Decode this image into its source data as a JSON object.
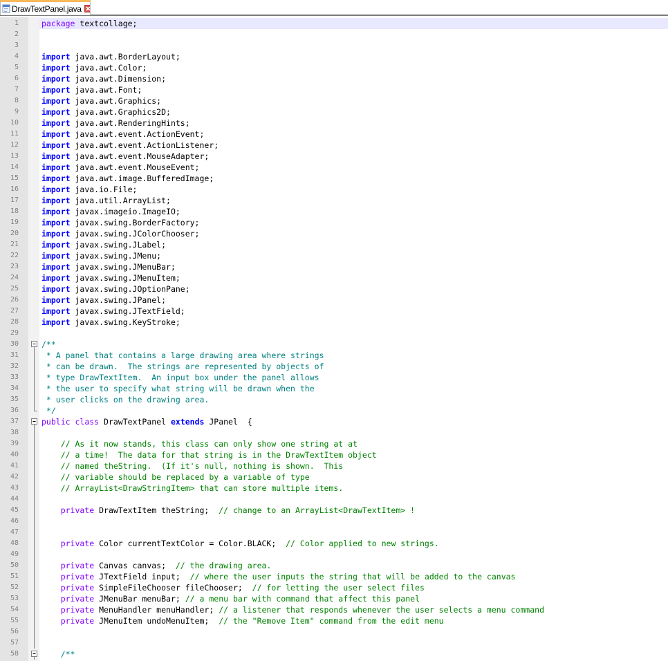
{
  "tab": {
    "filename": "DrawTextPanel.java",
    "icon": "java-file-icon",
    "close_icon": "close-icon"
  },
  "colors": {
    "keyword": "#0000ff",
    "type_keyword": "#8000ff",
    "comment": "#008000",
    "doc_comment": "#008080",
    "current_line": "#e8e8ff",
    "gutter": "#e4e4e4",
    "tab_accent": "#f7b95a"
  },
  "editor": {
    "current_line": 1,
    "lines": [
      {
        "n": "1",
        "segs": [
          {
            "c": "kw2",
            "t": "package"
          },
          {
            "c": "",
            "t": " textcollage;"
          }
        ]
      },
      {
        "n": "2",
        "segs": []
      },
      {
        "n": "3",
        "segs": []
      },
      {
        "n": "4",
        "segs": [
          {
            "c": "kw",
            "t": "import"
          },
          {
            "c": "",
            "t": " java.awt.BorderLayout;"
          }
        ]
      },
      {
        "n": "5",
        "segs": [
          {
            "c": "kw",
            "t": "import"
          },
          {
            "c": "",
            "t": " java.awt.Color;"
          }
        ]
      },
      {
        "n": "6",
        "segs": [
          {
            "c": "kw",
            "t": "import"
          },
          {
            "c": "",
            "t": " java.awt.Dimension;"
          }
        ]
      },
      {
        "n": "7",
        "segs": [
          {
            "c": "kw",
            "t": "import"
          },
          {
            "c": "",
            "t": " java.awt.Font;"
          }
        ]
      },
      {
        "n": "8",
        "segs": [
          {
            "c": "kw",
            "t": "import"
          },
          {
            "c": "",
            "t": " java.awt.Graphics;"
          }
        ]
      },
      {
        "n": "9",
        "segs": [
          {
            "c": "kw",
            "t": "import"
          },
          {
            "c": "",
            "t": " java.awt.Graphics2D;"
          }
        ]
      },
      {
        "n": "10",
        "segs": [
          {
            "c": "kw",
            "t": "import"
          },
          {
            "c": "",
            "t": " java.awt.RenderingHints;"
          }
        ]
      },
      {
        "n": "11",
        "segs": [
          {
            "c": "kw",
            "t": "import"
          },
          {
            "c": "",
            "t": " java.awt.event.ActionEvent;"
          }
        ]
      },
      {
        "n": "12",
        "segs": [
          {
            "c": "kw",
            "t": "import"
          },
          {
            "c": "",
            "t": " java.awt.event.ActionListener;"
          }
        ]
      },
      {
        "n": "13",
        "segs": [
          {
            "c": "kw",
            "t": "import"
          },
          {
            "c": "",
            "t": " java.awt.event.MouseAdapter;"
          }
        ]
      },
      {
        "n": "14",
        "segs": [
          {
            "c": "kw",
            "t": "import"
          },
          {
            "c": "",
            "t": " java.awt.event.MouseEvent;"
          }
        ]
      },
      {
        "n": "15",
        "segs": [
          {
            "c": "kw",
            "t": "import"
          },
          {
            "c": "",
            "t": " java.awt.image.BufferedImage;"
          }
        ]
      },
      {
        "n": "16",
        "segs": [
          {
            "c": "kw",
            "t": "import"
          },
          {
            "c": "",
            "t": " java.io.File;"
          }
        ]
      },
      {
        "n": "17",
        "segs": [
          {
            "c": "kw",
            "t": "import"
          },
          {
            "c": "",
            "t": " java.util.ArrayList;"
          }
        ]
      },
      {
        "n": "18",
        "segs": [
          {
            "c": "kw",
            "t": "import"
          },
          {
            "c": "",
            "t": " javax.imageio.ImageIO;"
          }
        ]
      },
      {
        "n": "19",
        "segs": [
          {
            "c": "kw",
            "t": "import"
          },
          {
            "c": "",
            "t": " javax.swing.BorderFactory;"
          }
        ]
      },
      {
        "n": "20",
        "segs": [
          {
            "c": "kw",
            "t": "import"
          },
          {
            "c": "",
            "t": " javax.swing.JColorChooser;"
          }
        ]
      },
      {
        "n": "21",
        "segs": [
          {
            "c": "kw",
            "t": "import"
          },
          {
            "c": "",
            "t": " javax.swing.JLabel;"
          }
        ]
      },
      {
        "n": "22",
        "segs": [
          {
            "c": "kw",
            "t": "import"
          },
          {
            "c": "",
            "t": " javax.swing.JMenu;"
          }
        ]
      },
      {
        "n": "23",
        "segs": [
          {
            "c": "kw",
            "t": "import"
          },
          {
            "c": "",
            "t": " javax.swing.JMenuBar;"
          }
        ]
      },
      {
        "n": "24",
        "segs": [
          {
            "c": "kw",
            "t": "import"
          },
          {
            "c": "",
            "t": " javax.swing.JMenuItem;"
          }
        ]
      },
      {
        "n": "25",
        "segs": [
          {
            "c": "kw",
            "t": "import"
          },
          {
            "c": "",
            "t": " javax.swing.JOptionPane;"
          }
        ]
      },
      {
        "n": "26",
        "segs": [
          {
            "c": "kw",
            "t": "import"
          },
          {
            "c": "",
            "t": " javax.swing.JPanel;"
          }
        ]
      },
      {
        "n": "27",
        "segs": [
          {
            "c": "kw",
            "t": "import"
          },
          {
            "c": "",
            "t": " javax.swing.JTextField;"
          }
        ]
      },
      {
        "n": "28",
        "segs": [
          {
            "c": "kw",
            "t": "import"
          },
          {
            "c": "",
            "t": " javax.swing.KeyStroke;"
          }
        ]
      },
      {
        "n": "29",
        "segs": []
      },
      {
        "n": "30",
        "fold": "open",
        "segs": [
          {
            "c": "dc",
            "t": "/**"
          }
        ]
      },
      {
        "n": "31",
        "fold": "line",
        "segs": [
          {
            "c": "dc",
            "t": " * A panel that contains a large drawing area where strings"
          }
        ]
      },
      {
        "n": "32",
        "fold": "line",
        "segs": [
          {
            "c": "dc",
            "t": " * can be drawn.  The strings are represented by objects of"
          }
        ]
      },
      {
        "n": "33",
        "fold": "line",
        "segs": [
          {
            "c": "dc",
            "t": " * type DrawTextItem.  An input box under the panel allows"
          }
        ]
      },
      {
        "n": "34",
        "fold": "line",
        "segs": [
          {
            "c": "dc",
            "t": " * the user to specify what string will be drawn when the"
          }
        ]
      },
      {
        "n": "35",
        "fold": "line",
        "segs": [
          {
            "c": "dc",
            "t": " * user clicks on the drawing area."
          }
        ]
      },
      {
        "n": "36",
        "fold": "end",
        "segs": [
          {
            "c": "dc",
            "t": " */"
          }
        ]
      },
      {
        "n": "37",
        "fold": "open",
        "segs": [
          {
            "c": "kw2",
            "t": "public"
          },
          {
            "c": "",
            "t": " "
          },
          {
            "c": "kw2",
            "t": "class"
          },
          {
            "c": "",
            "t": " DrawTextPanel "
          },
          {
            "c": "kw",
            "t": "extends"
          },
          {
            "c": "",
            "t": " JPanel  {"
          }
        ]
      },
      {
        "n": "38",
        "fold": "line",
        "segs": []
      },
      {
        "n": "39",
        "fold": "line",
        "segs": [
          {
            "c": "",
            "t": "    "
          },
          {
            "c": "cm",
            "t": "// As it now stands, this class can only show one string at at"
          }
        ]
      },
      {
        "n": "40",
        "fold": "line",
        "segs": [
          {
            "c": "",
            "t": "    "
          },
          {
            "c": "cm",
            "t": "// a time!  The data for that string is in the DrawTextItem object"
          }
        ]
      },
      {
        "n": "41",
        "fold": "line",
        "segs": [
          {
            "c": "",
            "t": "    "
          },
          {
            "c": "cm",
            "t": "// named theString.  (If it's null, nothing is shown.  This"
          }
        ]
      },
      {
        "n": "42",
        "fold": "line",
        "segs": [
          {
            "c": "",
            "t": "    "
          },
          {
            "c": "cm",
            "t": "// variable should be replaced by a variable of type"
          }
        ]
      },
      {
        "n": "43",
        "fold": "line",
        "segs": [
          {
            "c": "",
            "t": "    "
          },
          {
            "c": "cm",
            "t": "// ArrayList<DrawStringItem> that can store multiple items."
          }
        ]
      },
      {
        "n": "44",
        "fold": "line",
        "segs": []
      },
      {
        "n": "45",
        "fold": "line",
        "segs": [
          {
            "c": "",
            "t": "    "
          },
          {
            "c": "kw2",
            "t": "private"
          },
          {
            "c": "",
            "t": " DrawTextItem theString;  "
          },
          {
            "c": "cm",
            "t": "// change to an ArrayList<DrawTextItem> !"
          }
        ]
      },
      {
        "n": "46",
        "fold": "line",
        "segs": []
      },
      {
        "n": "47",
        "fold": "line",
        "segs": []
      },
      {
        "n": "48",
        "fold": "line",
        "segs": [
          {
            "c": "",
            "t": "    "
          },
          {
            "c": "kw2",
            "t": "private"
          },
          {
            "c": "",
            "t": " Color currentTextColor = Color.BLACK;  "
          },
          {
            "c": "cm",
            "t": "// Color applied to new strings."
          }
        ]
      },
      {
        "n": "49",
        "fold": "line",
        "segs": []
      },
      {
        "n": "50",
        "fold": "line",
        "segs": [
          {
            "c": "",
            "t": "    "
          },
          {
            "c": "kw2",
            "t": "private"
          },
          {
            "c": "",
            "t": " Canvas canvas;  "
          },
          {
            "c": "cm",
            "t": "// the drawing area."
          }
        ]
      },
      {
        "n": "51",
        "fold": "line",
        "segs": [
          {
            "c": "",
            "t": "    "
          },
          {
            "c": "kw2",
            "t": "private"
          },
          {
            "c": "",
            "t": " JTextField input;  "
          },
          {
            "c": "cm",
            "t": "// where the user inputs the string that will be added to the canvas"
          }
        ]
      },
      {
        "n": "52",
        "fold": "line",
        "segs": [
          {
            "c": "",
            "t": "    "
          },
          {
            "c": "kw2",
            "t": "private"
          },
          {
            "c": "",
            "t": " SimpleFileChooser fileChooser;  "
          },
          {
            "c": "cm",
            "t": "// for letting the user select files"
          }
        ]
      },
      {
        "n": "53",
        "fold": "line",
        "segs": [
          {
            "c": "",
            "t": "    "
          },
          {
            "c": "kw2",
            "t": "private"
          },
          {
            "c": "",
            "t": " JMenuBar menuBar; "
          },
          {
            "c": "cm",
            "t": "// a menu bar with command that affect this panel"
          }
        ]
      },
      {
        "n": "54",
        "fold": "line",
        "segs": [
          {
            "c": "",
            "t": "    "
          },
          {
            "c": "kw2",
            "t": "private"
          },
          {
            "c": "",
            "t": " MenuHandler menuHandler; "
          },
          {
            "c": "cm",
            "t": "// a listener that responds whenever the user selects a menu command"
          }
        ]
      },
      {
        "n": "55",
        "fold": "line",
        "segs": [
          {
            "c": "",
            "t": "    "
          },
          {
            "c": "kw2",
            "t": "private"
          },
          {
            "c": "",
            "t": " JMenuItem undoMenuItem;  "
          },
          {
            "c": "cm",
            "t": "// the \"Remove Item\" command from the edit menu"
          }
        ]
      },
      {
        "n": "56",
        "fold": "line",
        "segs": []
      },
      {
        "n": "57",
        "fold": "line",
        "segs": []
      },
      {
        "n": "58",
        "fold": "open",
        "segs": [
          {
            "c": "",
            "t": "    "
          },
          {
            "c": "dc",
            "t": "/**"
          }
        ]
      }
    ]
  }
}
